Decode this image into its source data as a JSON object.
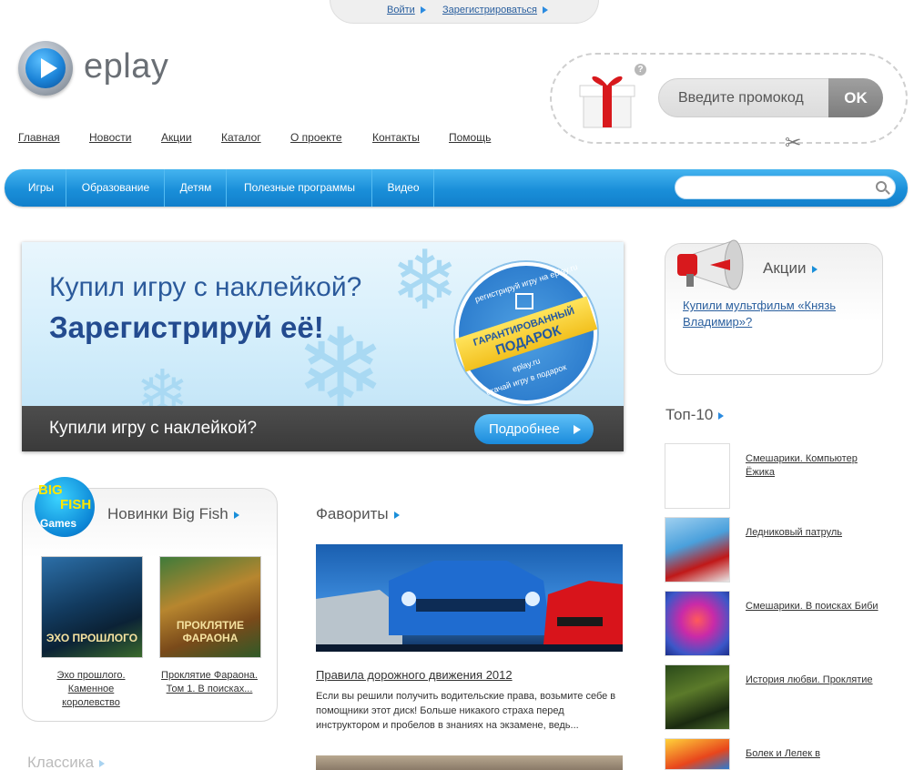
{
  "header": {
    "login": "Войти",
    "register": "Зарегистрироваться",
    "logo_text": "eplay"
  },
  "topnav": [
    "Главная",
    "Новости",
    "Акции",
    "Каталог",
    "О проекте",
    "Контакты",
    "Помощь"
  ],
  "promo": {
    "help": "?",
    "placeholder": "Введите промокод",
    "ok": "OK"
  },
  "menu": [
    "Игры",
    "Образование",
    "Детям",
    "Полезные программы",
    "Видео"
  ],
  "search": {
    "placeholder": ""
  },
  "banner": {
    "line1": "Купил игру с наклейкой?",
    "line2": "Зарегистрируй её!",
    "badge_top": "регистрируй игру на eplay.ru",
    "badge_ribbon_1": "ГАРАНТИРОВАННЫЙ",
    "badge_ribbon_2": "ПОДАРОК",
    "badge_site": "eplay.ru",
    "badge_bottom": "скачай игру в подарок",
    "bottom_text": "Купили игру с наклейкой?",
    "more_button": "Подробнее"
  },
  "bigfish": {
    "logo_big": "BIG",
    "logo_fish": "FISH",
    "logo_games": "Games",
    "title": "Новинки Big Fish",
    "items": [
      {
        "cover_title": "ЭХО ПРОШЛОГО",
        "caption": "Эхо прошлого. Каменное королевство"
      },
      {
        "cover_title": "ПРОКЛЯТИЕ ФАРАОНА",
        "caption": "Проклятие Фараона. Том 1. В поисках..."
      }
    ]
  },
  "favorites": {
    "title": "Фавориты",
    "item_title": "Правила дорожного движения 2012",
    "item_desc": "Если вы решили получить водительские права, возьмите себе в помощники этот диск! Больше никакого страха перед инструктором и пробелов в знаниях на экзамене, ведь..."
  },
  "classic": {
    "title": "Классика"
  },
  "aktsii": {
    "title": "Акции",
    "link": "Купили мультфильм «Князь Владимир»?"
  },
  "top10": {
    "title": "Топ-10",
    "items": [
      "Смешарики. Компьютер Ёжика",
      "Ледниковый патруль",
      "Смешарики. В поисках Биби",
      "История любви. Проклятие",
      "Болек и Лелек в"
    ]
  },
  "colors": {
    "menu_blue": "#1a8fd9",
    "link": "#2a5f9e",
    "banner_dark": "#3a3a3a"
  }
}
